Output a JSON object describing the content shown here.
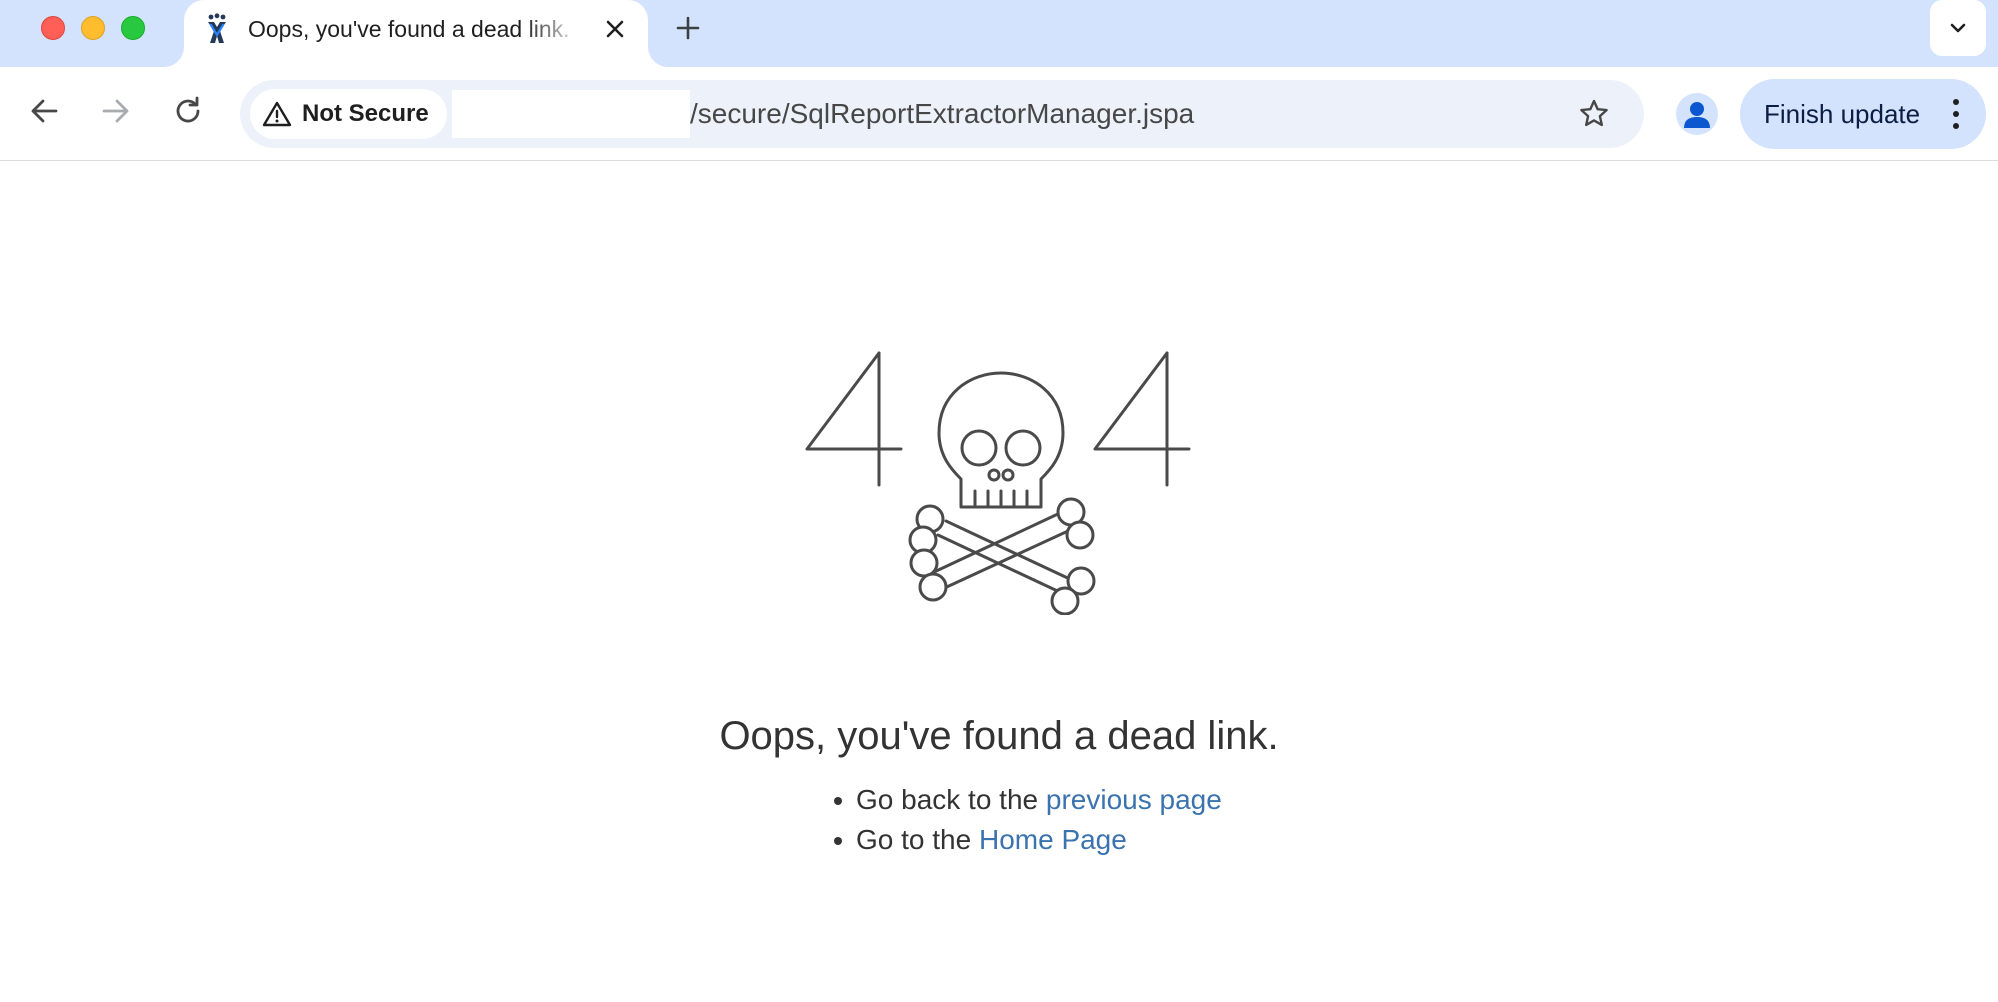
{
  "browser": {
    "tab": {
      "title": "Oops, you've found a dead link.",
      "favicon": "jira-logo-icon"
    },
    "new_tab_icon": "plus-icon",
    "tab_search_icon": "chevron-down-icon",
    "nav": {
      "back_icon": "arrow-left-icon",
      "forward_icon": "arrow-right-icon",
      "reload_icon": "reload-icon"
    },
    "omnibox": {
      "security_label": "Not Secure",
      "security_icon": "warning-triangle-icon",
      "url_path": "/secure/SqlReportExtractorManager.jspa",
      "bookmark_icon": "star-icon"
    },
    "profile_icon": "person-icon",
    "update_button_label": "Finish update",
    "menu_icon": "vertical-dots-icon"
  },
  "page": {
    "error_code_left": "4",
    "error_code_right": "4",
    "illustration": "skull-crossbones-icon",
    "headline": "Oops, you've found a dead link.",
    "suggestions": [
      {
        "prefix": "Go back to the ",
        "link": "previous page"
      },
      {
        "prefix": "Go to the ",
        "link": "Home Page"
      }
    ]
  },
  "colors": {
    "tabstrip_bg": "#d3e3fd",
    "omnibox_bg": "#edf2fa",
    "link": "#3b73af",
    "text": "#333333",
    "traffic_red": "#ff5f57",
    "traffic_yellow": "#febc2e",
    "traffic_green": "#28c840"
  }
}
